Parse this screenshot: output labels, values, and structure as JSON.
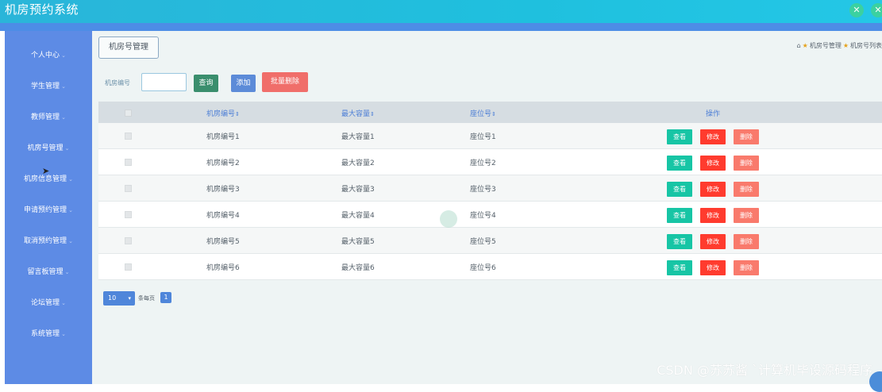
{
  "app": {
    "title": "机房预约系统"
  },
  "top_icons": [
    {
      "icon": "fullscreen-icon",
      "glyph": "✕"
    },
    {
      "icon": "user-icon",
      "glyph": "✕"
    }
  ],
  "sidebar": {
    "items": [
      {
        "label": "个人中心"
      },
      {
        "label": "学生管理"
      },
      {
        "label": "教师管理"
      },
      {
        "label": "机房号管理"
      },
      {
        "label": "机房信息管理"
      },
      {
        "label": "申请预约管理"
      },
      {
        "label": "取消预约管理"
      },
      {
        "label": "留言板管理"
      },
      {
        "label": "论坛管理"
      },
      {
        "label": "系统管理"
      }
    ]
  },
  "page": {
    "crumb_title": "机房号管理",
    "breadcrumb": {
      "home_icon": "home-icon",
      "item1": "机房号管理",
      "item2": "机房号列表"
    }
  },
  "search": {
    "label": "机房编号",
    "value": "",
    "query_btn": "查询",
    "add_btn": "添加",
    "batch_delete_btn": "批量删除"
  },
  "table": {
    "headers": {
      "room_no": "机房编号",
      "capacity": "最大容量",
      "seat_no": "座位号",
      "actions": "操作",
      "sort_icon": "⇕"
    },
    "rows": [
      {
        "room_no": "机房编号1",
        "capacity": "最大容量1",
        "seat_no": "座位号1"
      },
      {
        "room_no": "机房编号2",
        "capacity": "最大容量2",
        "seat_no": "座位号2"
      },
      {
        "room_no": "机房编号3",
        "capacity": "最大容量3",
        "seat_no": "座位号3"
      },
      {
        "room_no": "机房编号4",
        "capacity": "最大容量4",
        "seat_no": "座位号4"
      },
      {
        "room_no": "机房编号5",
        "capacity": "最大容量5",
        "seat_no": "座位号5"
      },
      {
        "room_no": "机房编号6",
        "capacity": "最大容量6",
        "seat_no": "座位号6"
      }
    ],
    "actions": {
      "view": "查看",
      "edit": "修改",
      "delete": "删除"
    }
  },
  "pagination": {
    "page_size": "10",
    "per_page_label": "条每页",
    "current_page": "1"
  },
  "watermark": "CSDN @苏苏酱  `计算机毕设源码程序",
  "colors": {
    "topbar": "#1fc0de",
    "sidebar": "#5d8be5",
    "view": "#17c5a5",
    "edit": "#ff3b2e",
    "delete": "#f97a6c"
  }
}
